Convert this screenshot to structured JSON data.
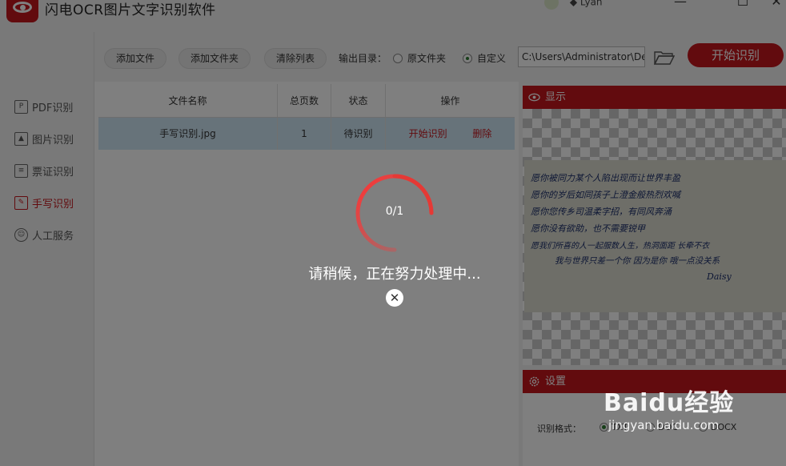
{
  "app": {
    "title": "闪电OCR图片文字识别软件",
    "user": "Lyan"
  },
  "sidebar": {
    "items": [
      {
        "label": "PDF识别",
        "icon": "pdf-icon"
      },
      {
        "label": "图片识别",
        "icon": "image-icon"
      },
      {
        "label": "票证识别",
        "icon": "ticket-icon"
      },
      {
        "label": "手写识别",
        "icon": "handwriting-icon",
        "active": true
      },
      {
        "label": "人工服务",
        "icon": "smiley-icon"
      }
    ]
  },
  "toolbar": {
    "add_file": "添加文件",
    "add_folder": "添加文件夹",
    "clear_list": "清除列表",
    "output_label": "输出目录：",
    "option_original": "原文件夹",
    "option_custom": "自定义",
    "output_path": "C:\\Users\\Administrator\\De",
    "start": "开始识别"
  },
  "table": {
    "headers": [
      "文件名称",
      "总页数",
      "状态",
      "操作"
    ],
    "rows": [
      {
        "name": "手写识别.jpg",
        "pages": "1",
        "status": "待识别",
        "action_start": "开始识别",
        "action_delete": "删除"
      }
    ]
  },
  "preview": {
    "title": "显示",
    "lines": [
      "愿你被同力某个人陷出现而让世界丰盈",
      "愿你的岁后如同孩子上澄金般热烈欢喊",
      "愿你您传乡司温柔字招，有同风奔涌",
      "愿你没有欲助，也不需要锐甲",
      "愿我们所喜的人一起服数人生，热洞面距  长牵不衣",
      "我与世界只差一个你  因为是你  哦一点没关系",
      "Daisy"
    ]
  },
  "settings": {
    "title": "设置",
    "format_label": "识别格式：",
    "formats": [
      "TXT",
      "DOC",
      "DOCX"
    ],
    "selected_format": "TXT"
  },
  "overlay": {
    "progress": "0/1",
    "message": "请稍候，正在努力处理中...",
    "watermark": "Baidu经验",
    "watermark_sub": "jingyan.baidu.com"
  },
  "colors": {
    "accent": "#c4161c",
    "row_selected": "#cfe6f5"
  }
}
